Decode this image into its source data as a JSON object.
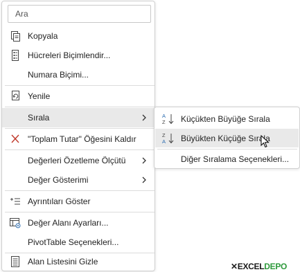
{
  "search": {
    "placeholder": "Ara"
  },
  "menu": {
    "items": [
      {
        "label": "Kopyala",
        "icon": "copy-icon"
      },
      {
        "label": "Hücreleri Biçimlendir...",
        "icon": "format-cells-icon"
      },
      {
        "label": "Numara Biçimi...",
        "icon": ""
      },
      {
        "label": "Yenile",
        "icon": "refresh-icon"
      },
      {
        "label": "Sırala",
        "icon": "",
        "submenu": true
      },
      {
        "label": "\"Toplam Tutar\" Öğesini Kaldır",
        "icon": "remove-x-icon"
      },
      {
        "label": "Değerleri Özetleme Ölçütü",
        "icon": "",
        "submenu": true
      },
      {
        "label": "Değer Gösterimi",
        "icon": "",
        "submenu": true
      },
      {
        "label": "Ayrıntıları Göster",
        "icon": "show-details-icon"
      },
      {
        "label": "Değer Alanı Ayarları...",
        "icon": "field-settings-icon"
      },
      {
        "label": "PivotTable Seçenekleri...",
        "icon": ""
      },
      {
        "label": "Alan Listesini Gizle",
        "icon": "field-list-icon"
      }
    ]
  },
  "submenu": {
    "items": [
      {
        "label": "Küçükten Büyüğe Sırala",
        "icon": "sort-ascending-icon"
      },
      {
        "label": "Büyükten Küçüğe Sırala",
        "icon": "sort-descending-icon"
      },
      {
        "label": "Diğer Sıralama Seçenekleri...",
        "icon": ""
      }
    ]
  },
  "logo": {
    "part1": "EXCEL",
    "part2": "DEPO"
  },
  "colors": {
    "remove_x": "#c0392b",
    "hover_bg": "#e9e9e9",
    "logo_green": "#2e9a3c"
  }
}
